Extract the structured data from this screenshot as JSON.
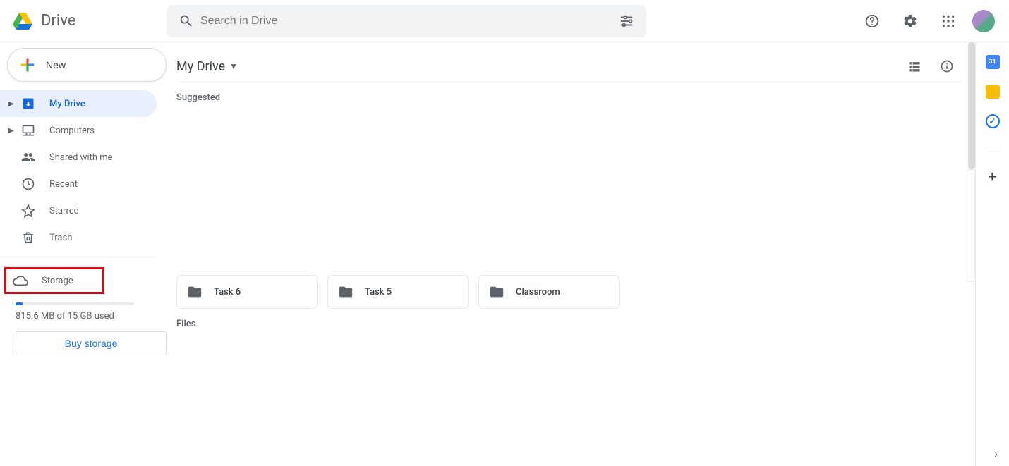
{
  "brand": {
    "name": "Drive"
  },
  "search": {
    "placeholder": "Search in Drive"
  },
  "sidebar": {
    "new_label": "New",
    "items": [
      {
        "label": "My Drive"
      },
      {
        "label": "Computers"
      },
      {
        "label": "Shared with me"
      },
      {
        "label": "Recent"
      },
      {
        "label": "Starred"
      },
      {
        "label": "Trash"
      }
    ],
    "storage": {
      "label": "Storage",
      "usage_text": "815.6 MB of 15 GB used",
      "buy_label": "Buy storage"
    }
  },
  "main": {
    "breadcrumb": "My Drive",
    "sections": {
      "suggested": "Suggested",
      "files": "Files"
    },
    "folders": [
      {
        "name": "Task 6"
      },
      {
        "name": "Task 5"
      },
      {
        "name": "Classroom"
      }
    ]
  }
}
